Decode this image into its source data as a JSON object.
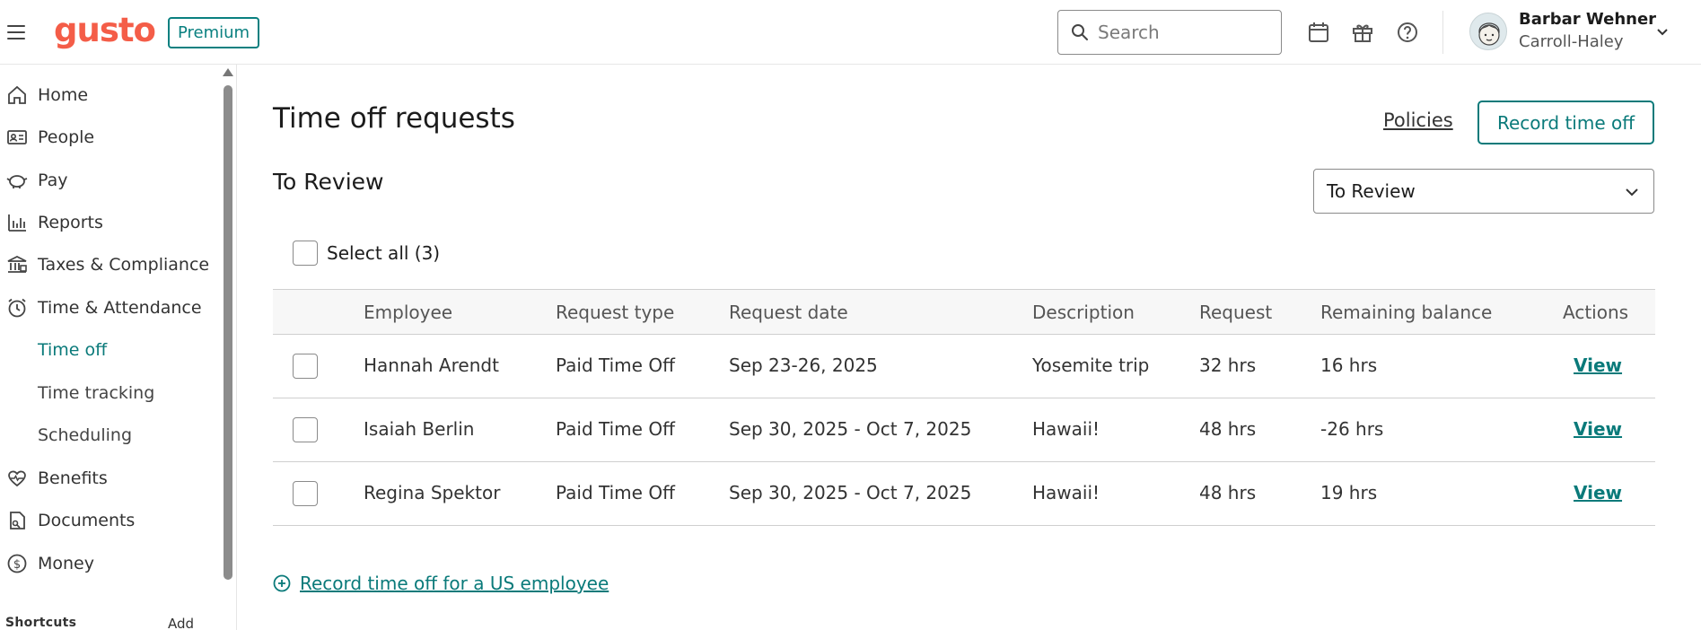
{
  "header": {
    "logo_text": "gusto",
    "plan_badge": "Premium",
    "search_placeholder": "Search",
    "icons": [
      "menu-icon",
      "calendar-icon",
      "gift-icon",
      "help-icon",
      "chevron-down-icon"
    ],
    "user": {
      "name": "Barbar Wehner",
      "company": "Carroll-Haley"
    }
  },
  "sidebar": {
    "items": [
      {
        "label": "Home",
        "icon": "home-icon"
      },
      {
        "label": "People",
        "icon": "id-card-icon"
      },
      {
        "label": "Pay",
        "icon": "piggy-bank-icon"
      },
      {
        "label": "Reports",
        "icon": "bar-chart-icon"
      },
      {
        "label": "Taxes & Compliance",
        "icon": "bank-icon"
      },
      {
        "label": "Time & Attendance",
        "icon": "clock-icon"
      }
    ],
    "sub_items": [
      {
        "label": "Time off",
        "active": true
      },
      {
        "label": "Time tracking",
        "active": false
      },
      {
        "label": "Scheduling",
        "active": false
      }
    ],
    "items_after": [
      {
        "label": "Benefits",
        "icon": "heart-icon"
      },
      {
        "label": "Documents",
        "icon": "document-icon"
      },
      {
        "label": "Money",
        "icon": "dollar-icon"
      }
    ],
    "shortcuts_label": "Shortcuts",
    "shortcuts_add": "Add"
  },
  "main": {
    "title": "Time off requests",
    "policies_link": "Policies",
    "record_button": "Record time off",
    "section_title": "To Review",
    "filter_value": "To Review",
    "select_all_label": "Select all (3)",
    "columns": [
      "Employee",
      "Request type",
      "Request date",
      "Description",
      "Request",
      "Remaining balance",
      "Actions"
    ],
    "rows": [
      {
        "employee": "Hannah Arendt",
        "type": "Paid Time Off",
        "date": "Sep 23-26, 2025",
        "description": "Yosemite trip",
        "request": "32 hrs",
        "balance": "16 hrs",
        "action": "View"
      },
      {
        "employee": "Isaiah Berlin",
        "type": "Paid Time Off",
        "date": "Sep 30, 2025 - Oct 7, 2025",
        "description": "Hawaii!",
        "request": "48 hrs",
        "balance": "-26 hrs",
        "action": "View"
      },
      {
        "employee": "Regina Spektor",
        "type": "Paid Time Off",
        "date": "Sep 30, 2025 - Oct 7, 2025",
        "description": "Hawaii!",
        "request": "48 hrs",
        "balance": "19 hrs",
        "action": "View"
      }
    ],
    "add_link": "Record time off for a US employee"
  },
  "colors": {
    "brand": "#f45d48",
    "accent": "#0a7a7a"
  }
}
